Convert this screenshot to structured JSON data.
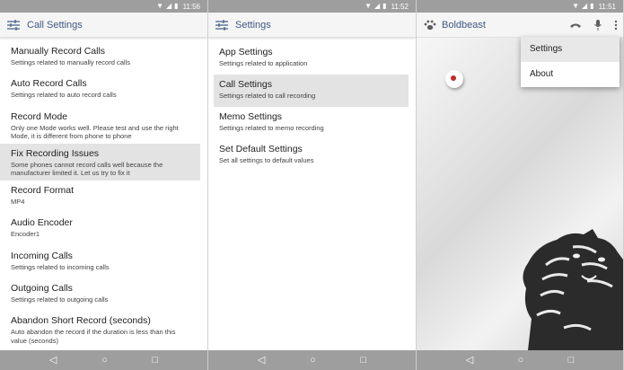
{
  "status_bars": [
    {
      "time": "11:56"
    },
    {
      "time": "11:52"
    },
    {
      "time": "11:51"
    }
  ],
  "screen1": {
    "title": "Call Settings",
    "items": [
      {
        "title": "Manually Record Calls",
        "subtitle": "Settings related to manually record calls"
      },
      {
        "title": "Auto Record Calls",
        "subtitle": "Settings related to auto record calls"
      },
      {
        "title": "Record Mode",
        "subtitle": "Only one Mode works well. Please test and use the right Mode, it is different from phone to phone"
      },
      {
        "title": "Fix Recording Issues",
        "subtitle": "Some phones cannot record calls well because the manufacturer limited it. Let us try to fix it"
      },
      {
        "title": "Record Format",
        "subtitle": "MP4"
      },
      {
        "title": "Audio Encoder",
        "subtitle": "Encoder1"
      },
      {
        "title": "Incoming Calls",
        "subtitle": "Settings related to incoming calls"
      },
      {
        "title": "Outgoing Calls",
        "subtitle": "Settings related to outgoing calls"
      },
      {
        "title": "Abandon Short Record (seconds)",
        "subtitle": "Auto abandon the record if the duration is less than this value (seconds)"
      }
    ]
  },
  "screen2": {
    "title": "Settings",
    "items": [
      {
        "title": "App Settings",
        "subtitle": "Settings related to application"
      },
      {
        "title": "Call Settings",
        "subtitle": "Settings related to call recording"
      },
      {
        "title": "Memo Settings",
        "subtitle": "Settings related to memo recording"
      },
      {
        "title": "Set Default Settings",
        "subtitle": "Set all settings to default values"
      }
    ]
  },
  "screen3": {
    "title": "Boldbeast",
    "menu": [
      {
        "label": "Settings"
      },
      {
        "label": "About"
      }
    ]
  },
  "colors": {
    "status_bar": "#9e9e9e",
    "title_text": "#3d5a80",
    "selected_row": "#e3e3e3",
    "record_dot": "#c62828"
  },
  "icons": {
    "settings_sliders": "sliders-icon",
    "paw": "paw-icon",
    "phone": "phone-icon",
    "mic": "mic-icon",
    "overflow": "more-vert-icon",
    "nav_back": "back-icon",
    "nav_home": "home-icon",
    "nav_recents": "recents-icon"
  }
}
